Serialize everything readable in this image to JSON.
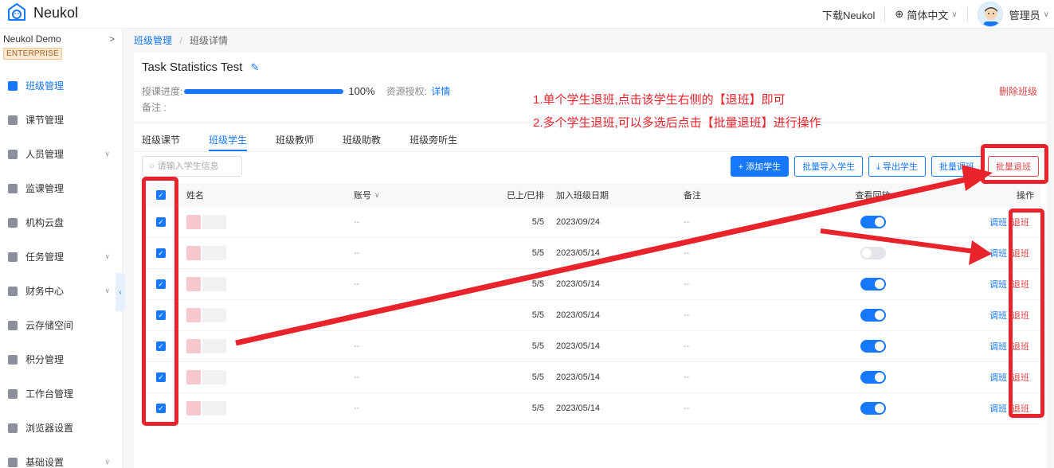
{
  "app": {
    "name": "Neukol"
  },
  "header": {
    "download": "下载Neukol",
    "language": "简体中文",
    "user": "管理员"
  },
  "sidebar": {
    "org_name": "Neukol Demo",
    "plan_badge": "ENTERPRISE",
    "items": [
      {
        "label": "班级管理",
        "icon": "class-icon",
        "active": true
      },
      {
        "label": "课节管理",
        "icon": "lesson-icon"
      },
      {
        "label": "人员管理",
        "icon": "people-icon",
        "expandable": true
      },
      {
        "label": "监课管理",
        "icon": "monitor-icon"
      },
      {
        "label": "机构云盘",
        "icon": "cloud-icon"
      },
      {
        "label": "任务管理",
        "icon": "task-icon",
        "expandable": true
      },
      {
        "label": "财务中心",
        "icon": "finance-icon",
        "expandable": true
      },
      {
        "label": "云存储空间",
        "icon": "storage-icon"
      },
      {
        "label": "积分管理",
        "icon": "points-icon"
      },
      {
        "label": "工作台管理",
        "icon": "workbench-icon"
      },
      {
        "label": "浏览器设置",
        "icon": "browser-icon"
      },
      {
        "label": "基础设置",
        "icon": "settings-icon",
        "expandable": true
      }
    ]
  },
  "breadcrumb": {
    "parent": "班级管理",
    "separator": "/",
    "current": "班级详情"
  },
  "class_info": {
    "title": "Task Statistics Test",
    "progress_label": "授课进度:",
    "progress_value": "100%",
    "progress_fraction": 1.0,
    "resource_label": "资源授权:",
    "resource_link": "详情",
    "remark_label": "备注 :",
    "delete_button": "删除班级"
  },
  "tabs": [
    {
      "label": "班级课节"
    },
    {
      "label": "班级学生",
      "active": true
    },
    {
      "label": "班级教师"
    },
    {
      "label": "班级助教"
    },
    {
      "label": "班级旁听生"
    }
  ],
  "search": {
    "placeholder": "请输入学生信息"
  },
  "actions": {
    "add_student": "+ 添加学生",
    "import": "批量导入学生",
    "export": "⤓ 导出学生",
    "batch_transfer": "批量调班",
    "batch_quit": "批量退班"
  },
  "table": {
    "headers": {
      "name": "姓名",
      "account": "账号",
      "attended": "已上/已排",
      "join_date": "加入班级日期",
      "note": "备注",
      "view": "查看回放",
      "ops": "操作"
    },
    "rows": [
      {
        "account": "--",
        "attended": "5/5",
        "join_date": "2023/09/24",
        "note": "--",
        "replay_on": true
      },
      {
        "account": "--",
        "attended": "5/5",
        "join_date": "2023/05/14",
        "note": "--",
        "replay_on": false
      },
      {
        "account": "--",
        "attended": "5/5",
        "join_date": "2023/05/14",
        "note": "--",
        "replay_on": true
      },
      {
        "account": "--",
        "attended": "5/5",
        "join_date": "2023/05/14",
        "note": "--",
        "replay_on": true
      },
      {
        "account": "--",
        "attended": "5/5",
        "join_date": "2023/05/14",
        "note": "--",
        "replay_on": true
      },
      {
        "account": "--",
        "attended": "5/5",
        "join_date": "2023/05/14",
        "note": "--",
        "replay_on": true
      },
      {
        "account": "--",
        "attended": "5/5",
        "join_date": "2023/05/14",
        "note": "--",
        "replay_on": true
      }
    ],
    "op_transfer": "调班",
    "op_quit": "退班"
  },
  "annotations": {
    "line1": "1.单个学生退班,点击该学生右侧的【退班】即可",
    "line2": "2.多个学生退班,可以多选后点击【批量退班】进行操作",
    "color": "#e8232b"
  }
}
